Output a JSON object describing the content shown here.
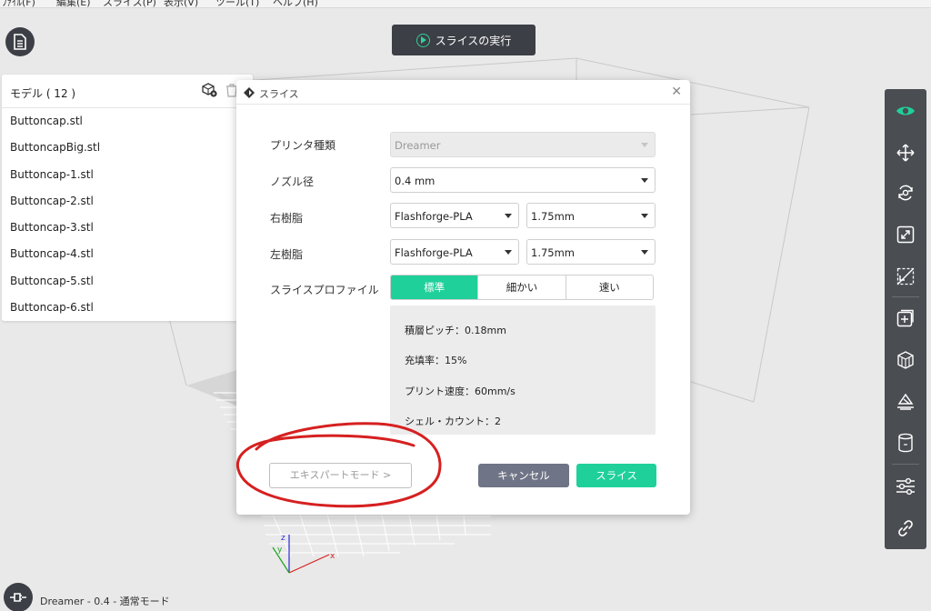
{
  "menubar": {
    "items": [
      "ﾌｧｲﾙ(F)",
      "編集(E)",
      "スライス(P)",
      "表示(V)",
      "ツール(T)",
      "ヘルプ(H)"
    ]
  },
  "toolbar": {
    "run_slice_label": "スライスの実行"
  },
  "model_panel": {
    "title": "モデル ( 12 )",
    "items": [
      "Buttoncap.stl",
      "ButtoncapBig.stl",
      "Buttoncap-1.stl",
      "Buttoncap-2.stl",
      "Buttoncap-3.stl",
      "Buttoncap-4.stl",
      "Buttoncap-5.stl",
      "Buttoncap-6.stl"
    ]
  },
  "dialog": {
    "title": "スライス",
    "printer_type": {
      "label": "プリンタ種類",
      "value": "Dreamer"
    },
    "nozzle": {
      "label": "ノズル径",
      "value": "0.4 mm"
    },
    "right_resin": {
      "label": "右樹脂",
      "material": "Flashforge-PLA",
      "diameter": "1.75mm"
    },
    "left_resin": {
      "label": "左樹脂",
      "material": "Flashforge-PLA",
      "diameter": "1.75mm"
    },
    "profile": {
      "label": "スライスプロファイル",
      "options": [
        "標準",
        "細かい",
        "速い"
      ],
      "selected": "標準"
    },
    "details": {
      "layer_pitch": "積層ピッチ：0.18mm",
      "infill": "充填率：15%",
      "print_speed": "プリント速度：60mm/s",
      "shell_count": "シェル・カウント：2"
    },
    "expert_mode_label": "エキスパートモード >",
    "cancel_label": "キャンセル",
    "slice_label": "スライス"
  },
  "status": {
    "text": "Dreamer - 0.4 - 通常モード"
  },
  "colors": {
    "accent": "#1fd09a",
    "toolbar_bg": "#4a4d52",
    "annotation_red": "#d62020"
  },
  "icons": {
    "right_toolbar": [
      "eye-icon",
      "move-icon",
      "rotate-icon",
      "scale-icon",
      "mirror-icon",
      "add-support-icon",
      "support-icon",
      "leveling-icon",
      "cylinder-icon",
      "settings-sliders-icon",
      "link-icon"
    ]
  }
}
